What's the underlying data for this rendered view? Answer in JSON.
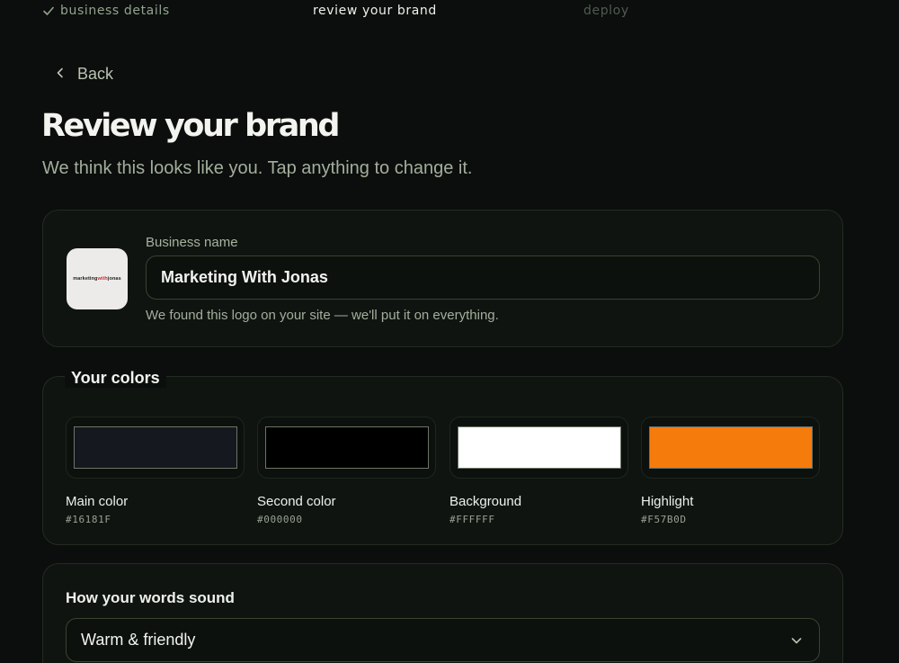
{
  "steps": [
    {
      "label": "business details"
    },
    {
      "label": "review your brand"
    },
    {
      "label": "deploy"
    }
  ],
  "back_label": "Back",
  "page": {
    "title": "Review your brand",
    "subtitle": "We think this looks like you. Tap anything to change it."
  },
  "business": {
    "label": "Business name",
    "value": "Marketing With Jonas",
    "hint": "We found this logo on your site — we'll put it on everything.",
    "logo_text_a": "marketing",
    "logo_text_b": "with",
    "logo_text_c": "jonas"
  },
  "colors": {
    "title": "Your colors",
    "items": [
      {
        "name": "Main color",
        "hex": "#16181F"
      },
      {
        "name": "Second color",
        "hex": "#000000"
      },
      {
        "name": "Background",
        "hex": "#FFFFFF"
      },
      {
        "name": "Highlight",
        "hex": "#F57B0D"
      }
    ]
  },
  "voice": {
    "title": "How your words sound",
    "value": "Warm & friendly"
  }
}
